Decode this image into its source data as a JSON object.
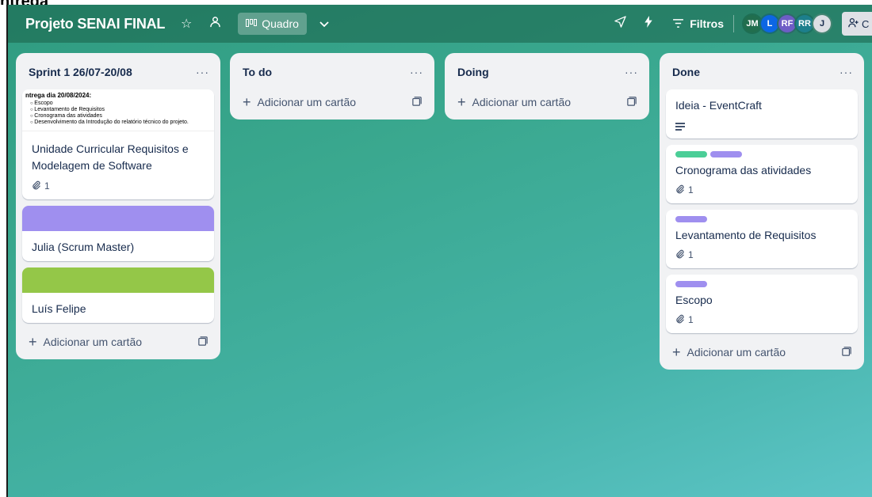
{
  "top_clip_text": "ntrega",
  "header": {
    "board_title": "Projeto SENAI FINAL",
    "view_label": "Quadro",
    "filters_label": "Filtros",
    "share_label": "C",
    "avatars": [
      {
        "initials": "JM",
        "color": "#216e4e"
      },
      {
        "initials": "L",
        "color": "#0c66e4"
      },
      {
        "initials": "RF",
        "color": "#6e5dc6"
      },
      {
        "initials": "RR",
        "color": "#1d7f8c"
      },
      {
        "initials": "J",
        "color": "#dcdfe4",
        "text_color": "#172b4d"
      }
    ]
  },
  "lists": [
    {
      "title": "Sprint 1 26/07-20/08",
      "menu": "···",
      "doc_cover": {
        "heading": "ntrega dia 20/08/2024:",
        "items": [
          "Escopo",
          "Levantamento de Requisitos",
          "Cronograma das atividades",
          "Desenvolvimento da Introdução do relatório técnico do projeto."
        ]
      },
      "cards": [
        {
          "title": "Unidade Curricular Requisitos e Modelagem de Software",
          "attachments": "1"
        },
        {
          "title": "Julia (Scrum Master)",
          "cover_color": "#9f8fef"
        },
        {
          "title": "Luís Felipe",
          "cover_color": "#94c748"
        }
      ],
      "add_label": "Adicionar um cartão"
    },
    {
      "title": "To do",
      "menu": "···",
      "add_label": "Adicionar um cartão"
    },
    {
      "title": "Doing",
      "menu": "···",
      "add_label": "Adicionar um cartão"
    },
    {
      "title": "Done",
      "menu": "···",
      "cards": [
        {
          "title": "Ideia - EventCraft"
        },
        {
          "title": "Cronograma das atividades",
          "attachments": "1",
          "labels": [
            "#4bce97",
            "#9f8fef"
          ]
        },
        {
          "title": "Levantamento de Requisitos",
          "attachments": "1",
          "labels": [
            "#9f8fef"
          ]
        },
        {
          "title": "Escopo",
          "attachments": "1",
          "labels": [
            "#9f8fef"
          ]
        }
      ],
      "add_label": "Adicionar um cartão"
    }
  ]
}
